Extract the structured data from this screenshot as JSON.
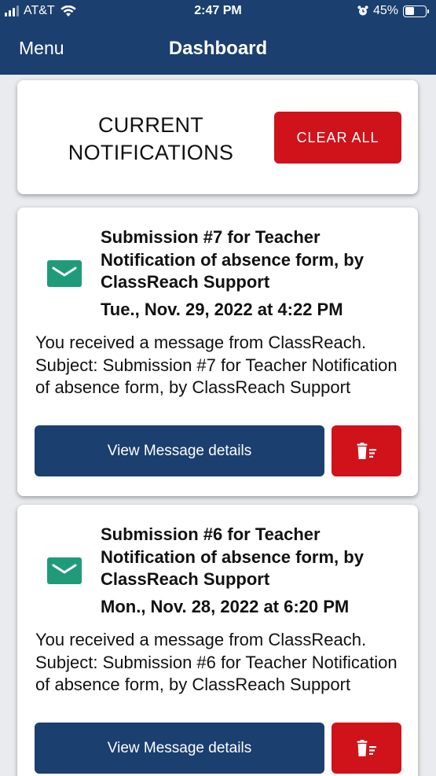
{
  "status_bar": {
    "carrier": "AT&T",
    "time": "2:47 PM",
    "battery_percent": "45%",
    "battery_level": 0.45
  },
  "nav": {
    "menu_label": "Menu",
    "title": "Dashboard"
  },
  "header": {
    "title": "CURRENT NOTIFICATIONS",
    "clear_all_label": "CLEAR ALL"
  },
  "notifications": [
    {
      "title": "Submission #7 for Teacher Notification of absence form, by ClassReach Support",
      "date": "Tue., Nov. 29, 2022 at 4:22 PM",
      "body": "You received a message from ClassReach. Subject: Submission #7 for Teacher Notification of absence form, by ClassReach Support",
      "view_label": "View Message details",
      "icon": "envelope-icon",
      "delete_icon": "trash-icon"
    },
    {
      "title": "Submission #6 for Teacher Notification of absence form, by ClassReach Support",
      "date": "Mon., Nov. 28, 2022 at 6:20 PM",
      "body": "You received a message from ClassReach. Subject: Submission #6 for Teacher Notification of absence form, by ClassReach Support",
      "view_label": "View Message details",
      "icon": "envelope-icon",
      "delete_icon": "trash-icon"
    }
  ],
  "colors": {
    "nav_blue": "#1b3f6e",
    "danger_red": "#d0121b",
    "envelope_green": "#1f9b7a",
    "background": "#e9ebee"
  }
}
